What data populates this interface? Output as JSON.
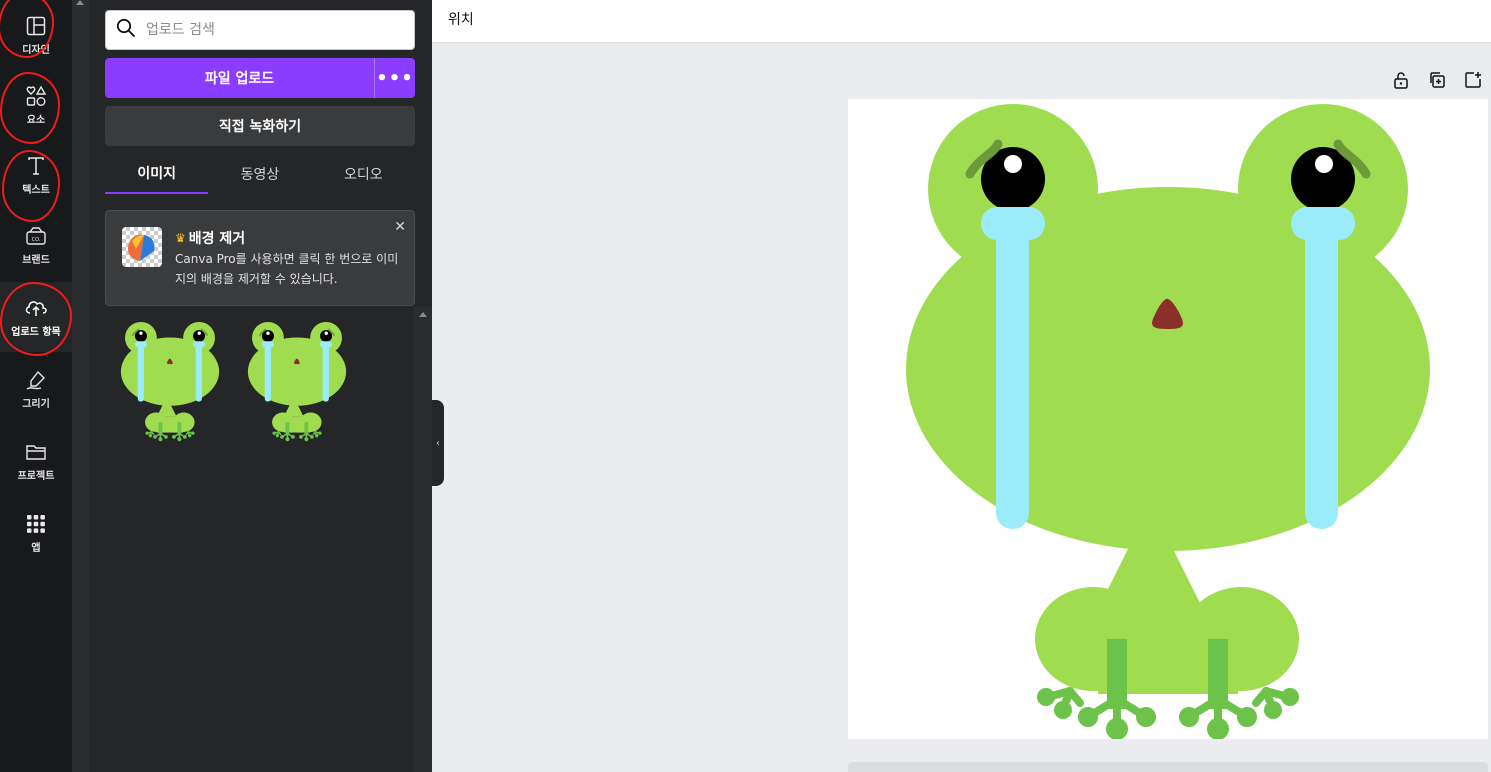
{
  "sidebar": {
    "items": [
      {
        "label": "디자인",
        "icon": "layout-icon"
      },
      {
        "label": "요소",
        "icon": "shapes-icon"
      },
      {
        "label": "텍스트",
        "icon": "text-icon"
      },
      {
        "label": "브랜드",
        "icon": "brand-icon"
      },
      {
        "label": "업로드 항목",
        "icon": "cloud-upload-icon",
        "active": true
      },
      {
        "label": "그리기",
        "icon": "draw-icon"
      },
      {
        "label": "프로젝트",
        "icon": "folder-icon"
      },
      {
        "label": "앱",
        "icon": "apps-grid-icon"
      }
    ]
  },
  "panel": {
    "search_placeholder": "업로드 검색",
    "upload_label": "파일 업로드",
    "more_label": "•••",
    "record_label": "직접 녹화하기",
    "tabs": [
      {
        "label": "이미지",
        "active": true
      },
      {
        "label": "동영상"
      },
      {
        "label": "오디오"
      }
    ],
    "promo": {
      "crown": "♛",
      "title": "배경 제거",
      "description": "Canva Pro를 사용하면 클릭 한 번으로 이미지의 배경을 제거할 수 있습니다.",
      "close": "✕"
    },
    "uploads_count": 2
  },
  "topbar": {
    "position_label": "위치"
  },
  "colors": {
    "accent": "#8b3dff",
    "frog_green": "#a0dc50",
    "tear_blue": "#9aecfb",
    "annotation_red": "#ef1c1c"
  }
}
